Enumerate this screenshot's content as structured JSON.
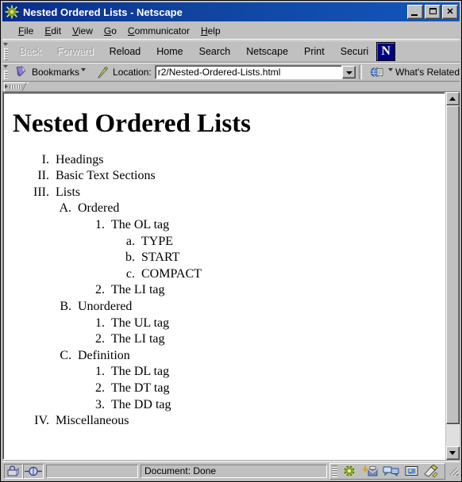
{
  "window": {
    "title": "Nested Ordered Lists - Netscape",
    "app_icon": "netscape-wheel-icon",
    "buttons": {
      "minimize": "minimize-button",
      "maximize": "maximize-button",
      "close": "close-button",
      "close_glyph": "✕"
    }
  },
  "menubar": {
    "items": [
      {
        "label": "File",
        "accel": "F"
      },
      {
        "label": "Edit",
        "accel": "E"
      },
      {
        "label": "View",
        "accel": "V"
      },
      {
        "label": "Go",
        "accel": "G"
      },
      {
        "label": "Communicator",
        "accel": "C"
      },
      {
        "label": "Help",
        "accel": "H"
      }
    ]
  },
  "navbar": {
    "buttons": [
      {
        "label": "Back",
        "disabled": true
      },
      {
        "label": "Forward",
        "disabled": true
      },
      {
        "label": "Reload",
        "disabled": false
      },
      {
        "label": "Home",
        "disabled": false
      },
      {
        "label": "Search",
        "disabled": false
      },
      {
        "label": "Netscape",
        "disabled": false
      },
      {
        "label": "Print",
        "disabled": false
      },
      {
        "label": "Securi",
        "disabled": false
      }
    ],
    "logo_letter": "N"
  },
  "locationbar": {
    "bookmarks_label": "Bookmarks",
    "location_label": "Location:",
    "location_value": "r2/Nested-Ordered-Lists.html",
    "location_placeholder": "",
    "whats_related_label": "What's Related"
  },
  "page": {
    "heading": "Nested Ordered Lists",
    "list": [
      {
        "marker": "I.",
        "text": "Headings"
      },
      {
        "marker": "II.",
        "text": "Basic Text Sections"
      },
      {
        "marker": "III.",
        "text": "Lists"
      },
      {
        "marker": "A.",
        "text": "Ordered"
      },
      {
        "marker": "1.",
        "text": "The OL tag"
      },
      {
        "marker": "a.",
        "text": "TYPE"
      },
      {
        "marker": "b.",
        "text": "START"
      },
      {
        "marker": "c.",
        "text": "COMPACT"
      },
      {
        "marker": "2.",
        "text": "The LI tag"
      },
      {
        "marker": "B.",
        "text": "Unordered"
      },
      {
        "marker": "1.",
        "text": "The UL tag"
      },
      {
        "marker": "2.",
        "text": "The LI tag"
      },
      {
        "marker": "C.",
        "text": "Definition"
      },
      {
        "marker": "1.",
        "text": "The DL tag"
      },
      {
        "marker": "2.",
        "text": "The DT tag"
      },
      {
        "marker": "3.",
        "text": "The DD tag"
      },
      {
        "marker": "IV.",
        "text": "Miscellaneous"
      }
    ]
  },
  "statusbar": {
    "status_text": "Document: Done",
    "security_icon": "padlock-icon",
    "connection_icon": "connection-icon",
    "component_icons": [
      "navigator-icon",
      "mailbox-icon",
      "newsgroups-icon",
      "address-book-icon",
      "composer-icon"
    ]
  },
  "colors": {
    "titlebar_start": "#0b2d8a",
    "titlebar_end": "#1257bd",
    "chrome": "#c0c0c0",
    "page_background": "#ffffff",
    "text": "#000000",
    "disabled_text": "#9a9a9a"
  }
}
